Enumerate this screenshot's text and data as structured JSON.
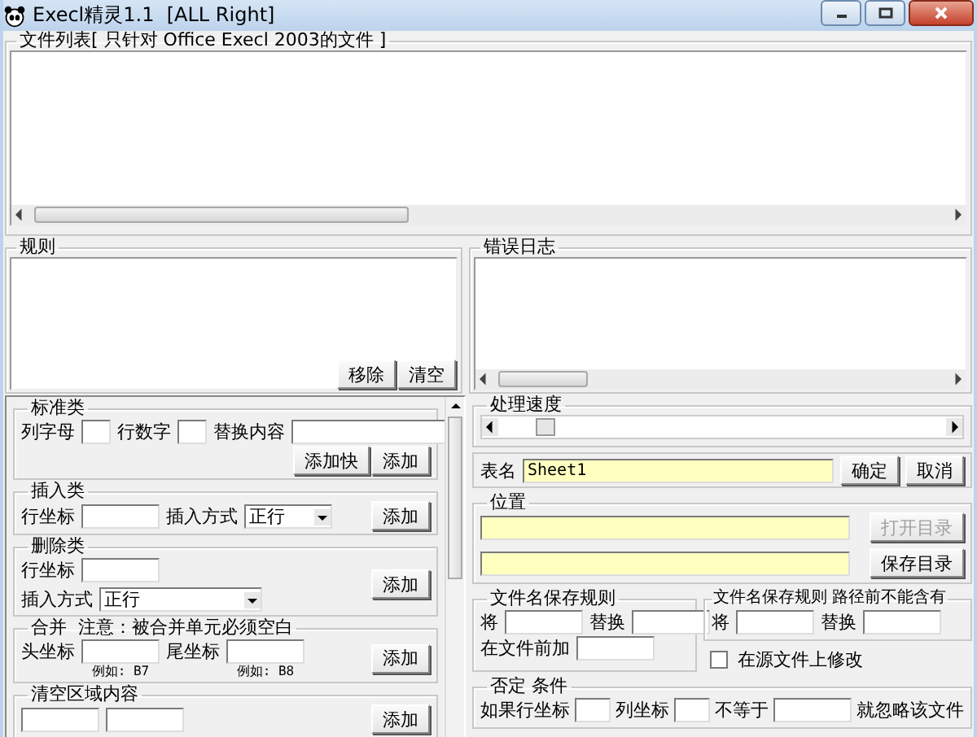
{
  "window": {
    "title": "Execl精灵1.1  [ALL Right]"
  },
  "file_list": {
    "legend": "文件列表[ 只针对 Office Execl 2003的文件 ]"
  },
  "rules": {
    "legend": "规则",
    "buttons": [
      "移除",
      "清空"
    ]
  },
  "error_log": {
    "legend": "错误日志"
  },
  "left_groups": [
    {
      "legend": "标准类",
      "kind": "buttons_below",
      "buttons": [
        "添加快",
        "添加"
      ],
      "rows": [
        [
          {
            "kind": "label",
            "text": "列字母"
          },
          {
            "kind": "box"
          },
          {
            "kind": "label",
            "text": "行数字"
          },
          {
            "kind": "box"
          },
          {
            "kind": "label",
            "text": "替换内容"
          },
          {
            "kind": "wide_field"
          }
        ]
      ]
    },
    {
      "legend": "插入类",
      "kind": "button_side",
      "buttons": [
        "添加"
      ],
      "rows": [
        [
          {
            "kind": "label",
            "text": "行坐标"
          },
          {
            "kind": "field"
          },
          {
            "kind": "label",
            "text": "插入方式"
          },
          {
            "kind": "select",
            "value": "正行"
          }
        ]
      ]
    },
    {
      "legend": "删除类",
      "kind": "button_side",
      "buttons": [
        "添加"
      ],
      "rows": [
        [
          {
            "kind": "label",
            "text": "行坐标"
          },
          {
            "kind": "field"
          }
        ],
        [
          {
            "kind": "label",
            "text": "插入方式"
          },
          {
            "kind": "wide_select",
            "value": "正行"
          }
        ]
      ]
    },
    {
      "legend": "合并  注意：被合并单元必须空白",
      "kind": "button_side",
      "buttons": [
        "添加"
      ],
      "rows": [
        [
          {
            "kind": "label",
            "text": "头坐标"
          },
          {
            "kind": "field",
            "note": "例如: B7"
          },
          {
            "kind": "label",
            "text": "尾坐标"
          },
          {
            "kind": "field",
            "note": "例如: B8"
          }
        ]
      ]
    },
    {
      "legend": "清空区域内容",
      "kind": "button_side",
      "buttons": [
        "添加"
      ],
      "rows": [
        [
          {
            "kind": "field"
          },
          {
            "kind": "field"
          }
        ]
      ]
    }
  ],
  "speed": {
    "legend": "处理速度",
    "level": 0.12
  },
  "sheet": {
    "label": "表名",
    "value": "Sheet1",
    "buttons": [
      "确定",
      "取消"
    ]
  },
  "location": {
    "legend": "位置",
    "rows": [
      {
        "button": "打开目录",
        "disabled": true
      },
      {
        "button": "保存目录",
        "disabled": false
      }
    ]
  },
  "filename_rule": {
    "legend": "文件名保存规则",
    "from_label": "将",
    "to_label": "替换",
    "prefix_label": "在文件前加"
  },
  "filename_rule_path": {
    "legend": "文件名保存规则 路径前不能含有",
    "from_label": "将",
    "to_label": "替换"
  },
  "modify_source": {
    "label": "在源文件上修改",
    "checked": false
  },
  "negate": {
    "legend": "否定 条件",
    "row_label": "如果行坐标",
    "col_label": "列坐标",
    "not_equal_label": "不等于",
    "result_label": "就忽略该文件"
  }
}
